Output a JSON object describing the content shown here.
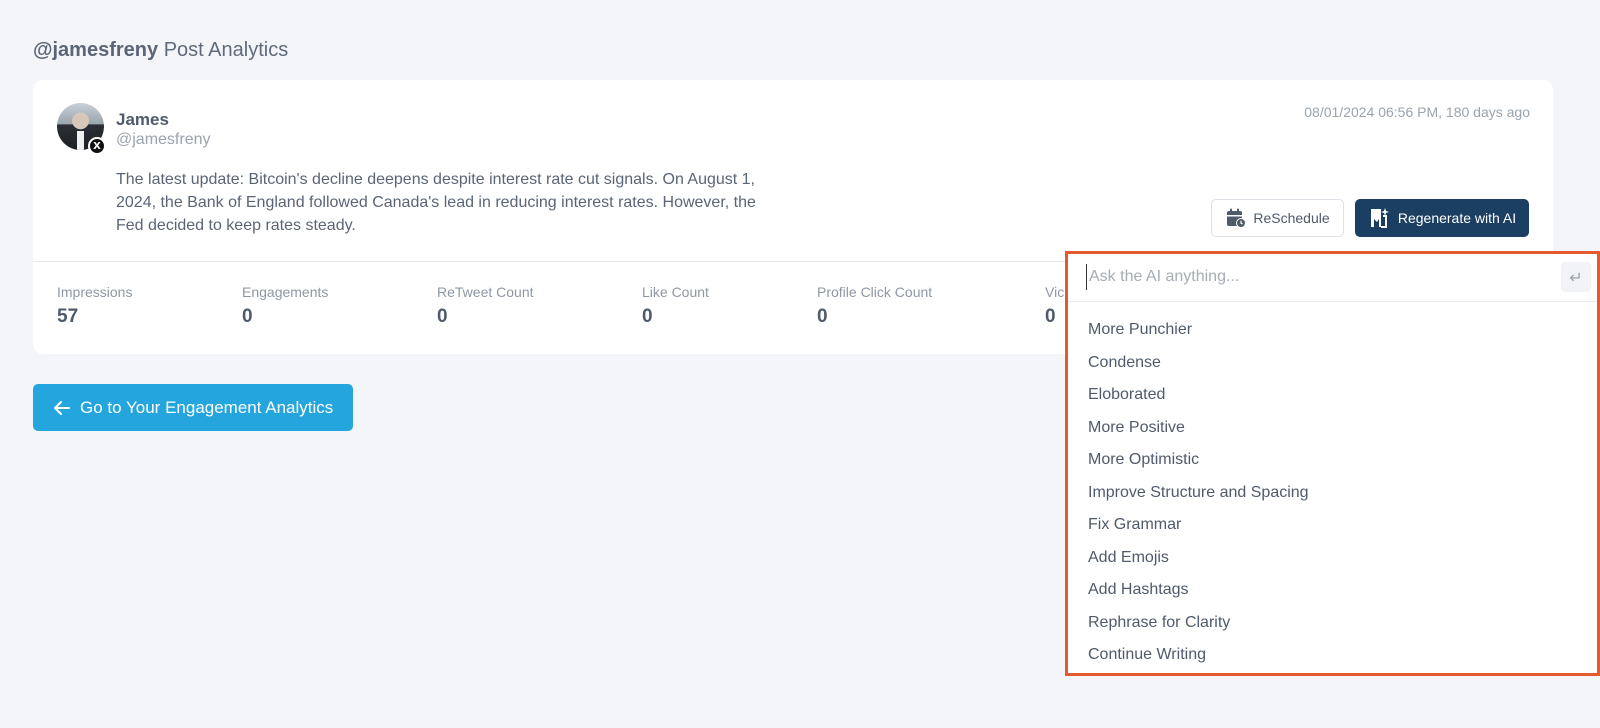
{
  "header": {
    "handle": "@jamesfreny",
    "title": "Post Analytics"
  },
  "post": {
    "author_name": "James",
    "author_handle": "@jamesfreny",
    "platform_badge": "X",
    "timestamp": "08/01/2024 06:56 PM, 180 days ago",
    "text": "The latest update: Bitcoin's decline deepens despite interest rate cut signals. On August 1, 2024, the Bank of England followed Canada's lead in reducing interest rates. However, the Fed decided to keep rates steady."
  },
  "actions": {
    "reschedule_label": "ReSchedule",
    "regenerate_label": "Regenerate with AI"
  },
  "metrics": [
    {
      "label": "Impressions",
      "value": "57"
    },
    {
      "label": "Engagements",
      "value": "0"
    },
    {
      "label": "ReTweet Count",
      "value": "0"
    },
    {
      "label": "Like Count",
      "value": "0"
    },
    {
      "label": "Profile Click Count",
      "value": "0"
    },
    {
      "label": "Vic",
      "value": "0"
    }
  ],
  "back_button_label": "Go to Your Engagement Analytics",
  "ai_menu": {
    "placeholder": "Ask the AI anything...",
    "enter_glyph": "↵",
    "options": [
      "More Punchier",
      "Condense",
      "Eloborated",
      "More Positive",
      "More Optimistic",
      "Improve Structure and Spacing",
      "Fix Grammar",
      "Add Emojis",
      "Add Hashtags",
      "Rephrase for Clarity",
      "Continue Writing"
    ]
  },
  "colors": {
    "primary_dark": "#1b3e63",
    "accent_blue": "#25a5dd",
    "highlight_border": "#e25a2d"
  }
}
